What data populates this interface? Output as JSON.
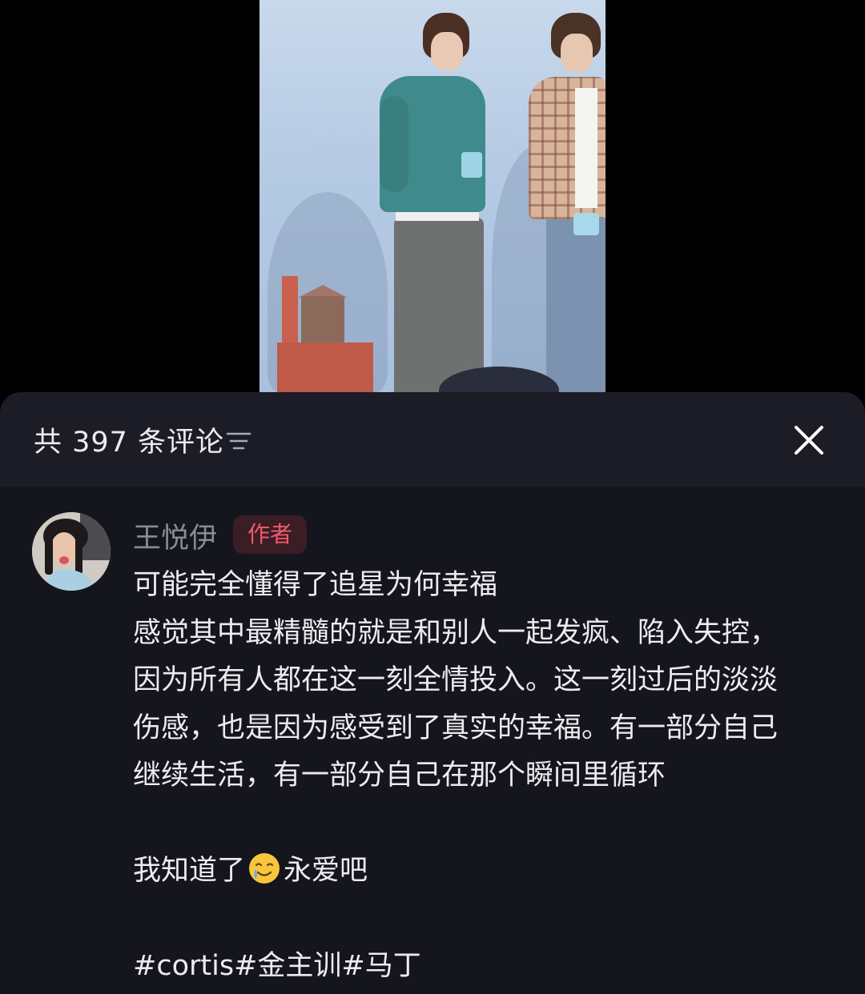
{
  "panel": {
    "comment_count_label": "共 397 条评论"
  },
  "comment": {
    "username": "王悦伊",
    "badge": "作者",
    "lines": [
      "可能完全懂得了追星为何幸福",
      "感觉其中最精髓的就是和别人一起发疯、陷入失控，",
      "因为所有人都在这一刻全情投入。这一刻过后的淡淡",
      "伤感，也是因为感受到了真实的幸福。有一部分自己",
      "继续生活，有一部分自己在那个瞬间里循环"
    ],
    "closing_before_emoji": "我知道了",
    "emoji": "crying-smile-emoji",
    "closing_after_emoji": "永爱吧",
    "hashtags": "#cortis#金主训#马丁"
  },
  "icons": {
    "sort": "sort-filter-icon",
    "close": "close-icon"
  },
  "colors": {
    "panel_bg": "#15151e",
    "header_bg": "#1c1c26",
    "badge_text": "#f05a6a",
    "badge_bg": "#3b1e25",
    "username": "#8a8b96",
    "body_text": "#ececf0"
  }
}
